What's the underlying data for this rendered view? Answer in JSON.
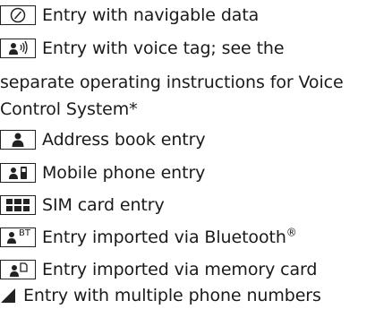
{
  "entries": [
    {
      "icon": "compass-icon",
      "label": "Entry with navigable data"
    },
    {
      "icon": "person-voice-icon",
      "label": "Entry with voice tag; see the",
      "label_cont1": "separate operating instructions for Voice",
      "label_cont2": "Control System*"
    },
    {
      "icon": "person-icon",
      "label": "Address book entry"
    },
    {
      "icon": "person-mobile-icon",
      "label": "Mobile phone entry"
    },
    {
      "icon": "sim-card-icon",
      "label": "SIM card entry"
    },
    {
      "icon": "person-bluetooth-icon",
      "icon_text": "BT",
      "label": "Entry imported via Bluetooth",
      "label_suffix": "®"
    },
    {
      "icon": "person-memory-card-icon",
      "label": "Entry imported via memory card"
    },
    {
      "icon": "corner-triangle-icon",
      "label": "Entry with multiple phone numbers"
    }
  ]
}
